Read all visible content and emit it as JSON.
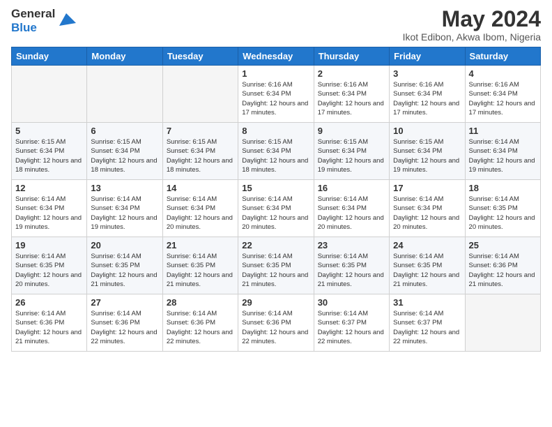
{
  "logo": {
    "general": "General",
    "blue": "Blue"
  },
  "header": {
    "month_year": "May 2024",
    "location": "Ikot Edibon, Akwa Ibom, Nigeria"
  },
  "weekdays": [
    "Sunday",
    "Monday",
    "Tuesday",
    "Wednesday",
    "Thursday",
    "Friday",
    "Saturday"
  ],
  "weeks": [
    [
      {
        "day": "",
        "info": ""
      },
      {
        "day": "",
        "info": ""
      },
      {
        "day": "",
        "info": ""
      },
      {
        "day": "1",
        "info": "Sunrise: 6:16 AM\nSunset: 6:34 PM\nDaylight: 12 hours and 17 minutes."
      },
      {
        "day": "2",
        "info": "Sunrise: 6:16 AM\nSunset: 6:34 PM\nDaylight: 12 hours and 17 minutes."
      },
      {
        "day": "3",
        "info": "Sunrise: 6:16 AM\nSunset: 6:34 PM\nDaylight: 12 hours and 17 minutes."
      },
      {
        "day": "4",
        "info": "Sunrise: 6:16 AM\nSunset: 6:34 PM\nDaylight: 12 hours and 17 minutes."
      }
    ],
    [
      {
        "day": "5",
        "info": "Sunrise: 6:15 AM\nSunset: 6:34 PM\nDaylight: 12 hours and 18 minutes."
      },
      {
        "day": "6",
        "info": "Sunrise: 6:15 AM\nSunset: 6:34 PM\nDaylight: 12 hours and 18 minutes."
      },
      {
        "day": "7",
        "info": "Sunrise: 6:15 AM\nSunset: 6:34 PM\nDaylight: 12 hours and 18 minutes."
      },
      {
        "day": "8",
        "info": "Sunrise: 6:15 AM\nSunset: 6:34 PM\nDaylight: 12 hours and 18 minutes."
      },
      {
        "day": "9",
        "info": "Sunrise: 6:15 AM\nSunset: 6:34 PM\nDaylight: 12 hours and 19 minutes."
      },
      {
        "day": "10",
        "info": "Sunrise: 6:15 AM\nSunset: 6:34 PM\nDaylight: 12 hours and 19 minutes."
      },
      {
        "day": "11",
        "info": "Sunrise: 6:14 AM\nSunset: 6:34 PM\nDaylight: 12 hours and 19 minutes."
      }
    ],
    [
      {
        "day": "12",
        "info": "Sunrise: 6:14 AM\nSunset: 6:34 PM\nDaylight: 12 hours and 19 minutes."
      },
      {
        "day": "13",
        "info": "Sunrise: 6:14 AM\nSunset: 6:34 PM\nDaylight: 12 hours and 19 minutes."
      },
      {
        "day": "14",
        "info": "Sunrise: 6:14 AM\nSunset: 6:34 PM\nDaylight: 12 hours and 20 minutes."
      },
      {
        "day": "15",
        "info": "Sunrise: 6:14 AM\nSunset: 6:34 PM\nDaylight: 12 hours and 20 minutes."
      },
      {
        "day": "16",
        "info": "Sunrise: 6:14 AM\nSunset: 6:34 PM\nDaylight: 12 hours and 20 minutes."
      },
      {
        "day": "17",
        "info": "Sunrise: 6:14 AM\nSunset: 6:34 PM\nDaylight: 12 hours and 20 minutes."
      },
      {
        "day": "18",
        "info": "Sunrise: 6:14 AM\nSunset: 6:35 PM\nDaylight: 12 hours and 20 minutes."
      }
    ],
    [
      {
        "day": "19",
        "info": "Sunrise: 6:14 AM\nSunset: 6:35 PM\nDaylight: 12 hours and 20 minutes."
      },
      {
        "day": "20",
        "info": "Sunrise: 6:14 AM\nSunset: 6:35 PM\nDaylight: 12 hours and 21 minutes."
      },
      {
        "day": "21",
        "info": "Sunrise: 6:14 AM\nSunset: 6:35 PM\nDaylight: 12 hours and 21 minutes."
      },
      {
        "day": "22",
        "info": "Sunrise: 6:14 AM\nSunset: 6:35 PM\nDaylight: 12 hours and 21 minutes."
      },
      {
        "day": "23",
        "info": "Sunrise: 6:14 AM\nSunset: 6:35 PM\nDaylight: 12 hours and 21 minutes."
      },
      {
        "day": "24",
        "info": "Sunrise: 6:14 AM\nSunset: 6:35 PM\nDaylight: 12 hours and 21 minutes."
      },
      {
        "day": "25",
        "info": "Sunrise: 6:14 AM\nSunset: 6:36 PM\nDaylight: 12 hours and 21 minutes."
      }
    ],
    [
      {
        "day": "26",
        "info": "Sunrise: 6:14 AM\nSunset: 6:36 PM\nDaylight: 12 hours and 21 minutes."
      },
      {
        "day": "27",
        "info": "Sunrise: 6:14 AM\nSunset: 6:36 PM\nDaylight: 12 hours and 22 minutes."
      },
      {
        "day": "28",
        "info": "Sunrise: 6:14 AM\nSunset: 6:36 PM\nDaylight: 12 hours and 22 minutes."
      },
      {
        "day": "29",
        "info": "Sunrise: 6:14 AM\nSunset: 6:36 PM\nDaylight: 12 hours and 22 minutes."
      },
      {
        "day": "30",
        "info": "Sunrise: 6:14 AM\nSunset: 6:37 PM\nDaylight: 12 hours and 22 minutes."
      },
      {
        "day": "31",
        "info": "Sunrise: 6:14 AM\nSunset: 6:37 PM\nDaylight: 12 hours and 22 minutes."
      },
      {
        "day": "",
        "info": ""
      }
    ]
  ]
}
